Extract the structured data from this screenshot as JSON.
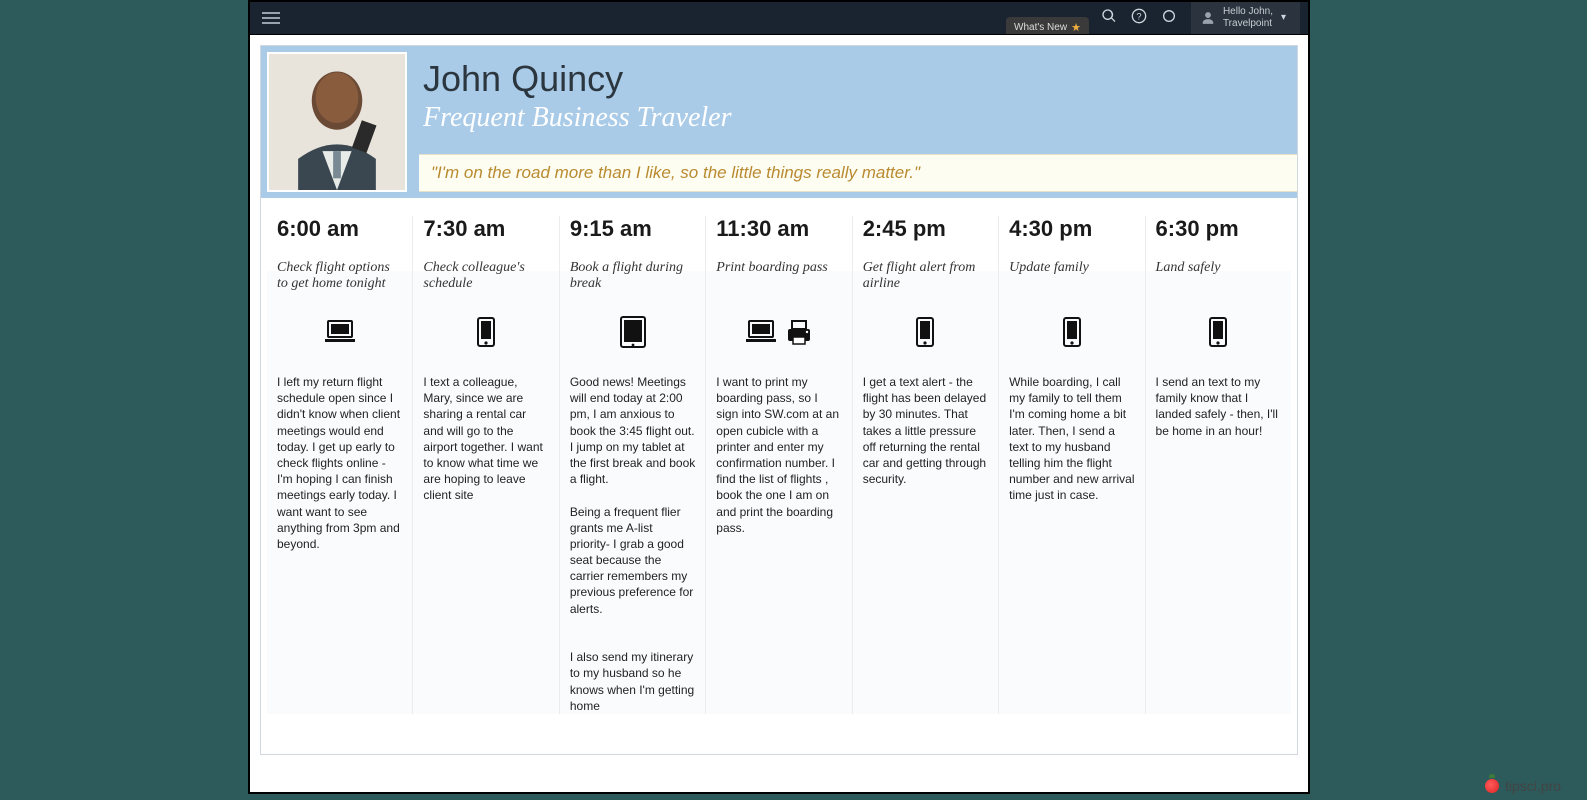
{
  "topbar": {
    "whats_new": "What's New",
    "user_greeting": "Hello John,",
    "user_org": "Travelpoint"
  },
  "persona": {
    "name": "John Quincy",
    "role": "Frequent Business Traveler",
    "quote": "\"I'm on the road more than I like, so the little things really matter.\""
  },
  "columns": [
    {
      "time": "6:00 am",
      "activity": "Check flight options to get home tonight",
      "devices": [
        "laptop"
      ],
      "story": "I left my return flight schedule open since I didn't know when client meetings would end today. I get up early to check flights online - I'm hoping I can finish meetings early today. I want want to see anything from 3pm and beyond."
    },
    {
      "time": "7:30 am",
      "activity": "Check colleague's schedule",
      "devices": [
        "phone"
      ],
      "story": "I text a colleague, Mary, since we are sharing a rental car and will go to the airport together. I want to know what time we are hoping to leave client site"
    },
    {
      "time": "9:15 am",
      "activity": "Book a flight during break",
      "devices": [
        "tablet"
      ],
      "story": "Good news! Meetings will end today at 2:00 pm, I am anxious to book the 3:45 flight out. I jump on my tablet at the first break and book a flight.\n\nBeing a frequent flier grants me A-list priority- I grab a good seat because the carrier remembers my previous preference for alerts.\n\n\nI also send my itinerary to my husband so he knows when I'm getting home"
    },
    {
      "time": "11:30 am",
      "activity": "Print boarding pass",
      "devices": [
        "laptop",
        "printer"
      ],
      "story": "I want to print my boarding pass, so I sign into SW.com at an open cubicle with a printer and enter my confirmation number. I find the list of flights , book the one I am on and print the boarding pass."
    },
    {
      "time": "2:45 pm",
      "activity": "Get flight alert from airline",
      "devices": [
        "phone"
      ],
      "story": "I get a text alert - the flight has been delayed by 30 minutes. That takes a little pressure off returning the rental car and getting through security."
    },
    {
      "time": "4:30 pm",
      "activity": "Update family",
      "devices": [
        "phone"
      ],
      "story": "While boarding, I call my family to tell them I'm coming home a bit later. Then, I send a text to my husband telling him the flight number and new arrival time just in case."
    },
    {
      "time": "6:30 pm",
      "activity": "Land safely",
      "devices": [
        "phone"
      ],
      "story": "I send an text to my family know that I landed safely - then, I'll be home in an hour!"
    }
  ],
  "watermark": "tipsci.pro"
}
